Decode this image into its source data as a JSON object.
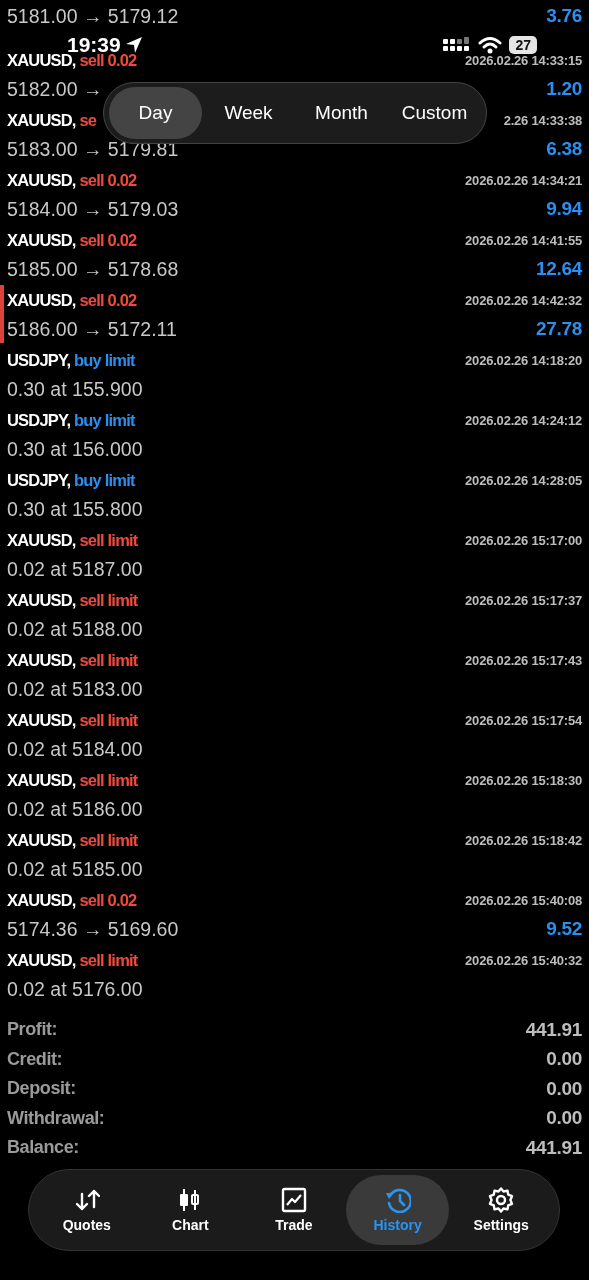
{
  "status_bar": {
    "time": "19:39",
    "battery": "27"
  },
  "period_tabs": [
    {
      "label": "Day",
      "selected": true
    },
    {
      "label": "Week",
      "selected": false
    },
    {
      "label": "Month",
      "selected": false
    },
    {
      "label": "Custom",
      "selected": false
    }
  ],
  "history": [
    {
      "kind": "deal",
      "detail": "5181.00 → 5179.12",
      "profit": "3.76",
      "selected": false
    },
    {
      "kind": "deal",
      "symbol": "XAUUSD,",
      "side": "sell 0.02",
      "color": "#ef4a3e",
      "time": "2026.02.26 14:33:15",
      "detail": "5182.00 →",
      "profit": "1.20",
      "selected": false
    },
    {
      "kind": "deal",
      "symbol": "XAUUSD,",
      "side": "se",
      "color": "#ef4a3e",
      "time": "2.26 14:33:38",
      "detail": "5183.00 → 5179.81",
      "profit": "6.38",
      "selected": false
    },
    {
      "kind": "deal",
      "symbol": "XAUUSD,",
      "side": "sell 0.02",
      "color": "#ef4a3e",
      "time": "2026.02.26 14:34:21",
      "detail": "5184.00 → 5179.03",
      "profit": "9.94",
      "selected": false
    },
    {
      "kind": "deal",
      "symbol": "XAUUSD,",
      "side": "sell 0.02",
      "color": "#ef4a3e",
      "time": "2026.02.26 14:41:55",
      "detail": "5185.00 → 5178.68",
      "profit": "12.64",
      "selected": false
    },
    {
      "kind": "deal",
      "symbol": "XAUUSD,",
      "side": "sell 0.02",
      "color": "#ef4a3e",
      "time": "2026.02.26 14:42:32",
      "detail": "5186.00 → 5172.11",
      "profit": "27.78",
      "selected": true
    },
    {
      "kind": "order",
      "symbol": "USDJPY,",
      "side": "buy limit",
      "color": "#2a8ff0",
      "time": "2026.02.26 14:18:20",
      "detail": "0.30 at 155.900",
      "selected": false
    },
    {
      "kind": "order",
      "symbol": "USDJPY,",
      "side": "buy limit",
      "color": "#2a8ff0",
      "time": "2026.02.26 14:24:12",
      "detail": "0.30 at 156.000",
      "selected": false
    },
    {
      "kind": "order",
      "symbol": "USDJPY,",
      "side": "buy limit",
      "color": "#2a8ff0",
      "time": "2026.02.26 14:28:05",
      "detail": "0.30 at 155.800",
      "selected": false
    },
    {
      "kind": "order",
      "symbol": "XAUUSD,",
      "side": "sell limit",
      "color": "#ef4a3e",
      "time": "2026.02.26 15:17:00",
      "detail": "0.02 at 5187.00",
      "selected": false
    },
    {
      "kind": "order",
      "symbol": "XAUUSD,",
      "side": "sell limit",
      "color": "#ef4a3e",
      "time": "2026.02.26 15:17:37",
      "detail": "0.02 at 5188.00",
      "selected": false
    },
    {
      "kind": "order",
      "symbol": "XAUUSD,",
      "side": "sell limit",
      "color": "#ef4a3e",
      "time": "2026.02.26 15:17:43",
      "detail": "0.02 at 5183.00",
      "selected": false
    },
    {
      "kind": "order",
      "symbol": "XAUUSD,",
      "side": "sell limit",
      "color": "#ef4a3e",
      "time": "2026.02.26 15:17:54",
      "detail": "0.02 at 5184.00",
      "selected": false
    },
    {
      "kind": "order",
      "symbol": "XAUUSD,",
      "side": "sell limit",
      "color": "#ef4a3e",
      "time": "2026.02.26 15:18:30",
      "detail": "0.02 at 5186.00",
      "selected": false
    },
    {
      "kind": "order",
      "symbol": "XAUUSD,",
      "side": "sell limit",
      "color": "#ef4a3e",
      "time": "2026.02.26 15:18:42",
      "detail": "0.02 at 5185.00",
      "selected": false
    },
    {
      "kind": "deal",
      "symbol": "XAUUSD,",
      "side": "sell 0.02",
      "color": "#ef4a3e",
      "time": "2026.02.26 15:40:08",
      "detail": "5174.36 → 5169.60",
      "profit": "9.52",
      "selected": false
    },
    {
      "kind": "order",
      "symbol": "XAUUSD,",
      "side": "sell limit",
      "color": "#ef4a3e",
      "time": "2026.02.26 15:40:32",
      "detail": "0.02 at 5176.00",
      "selected": false
    }
  ],
  "summary": [
    {
      "label": "Profit:",
      "value": "441.91"
    },
    {
      "label": "Credit:",
      "value": "0.00"
    },
    {
      "label": "Deposit:",
      "value": "0.00"
    },
    {
      "label": "Withdrawal:",
      "value": "0.00"
    },
    {
      "label": "Balance:",
      "value": "441.91"
    }
  ],
  "tab_bar": [
    {
      "label": "Quotes",
      "selected": false
    },
    {
      "label": "Chart",
      "selected": false
    },
    {
      "label": "Trade",
      "selected": false
    },
    {
      "label": "History",
      "selected": true
    },
    {
      "label": "Settings",
      "selected": false
    }
  ]
}
